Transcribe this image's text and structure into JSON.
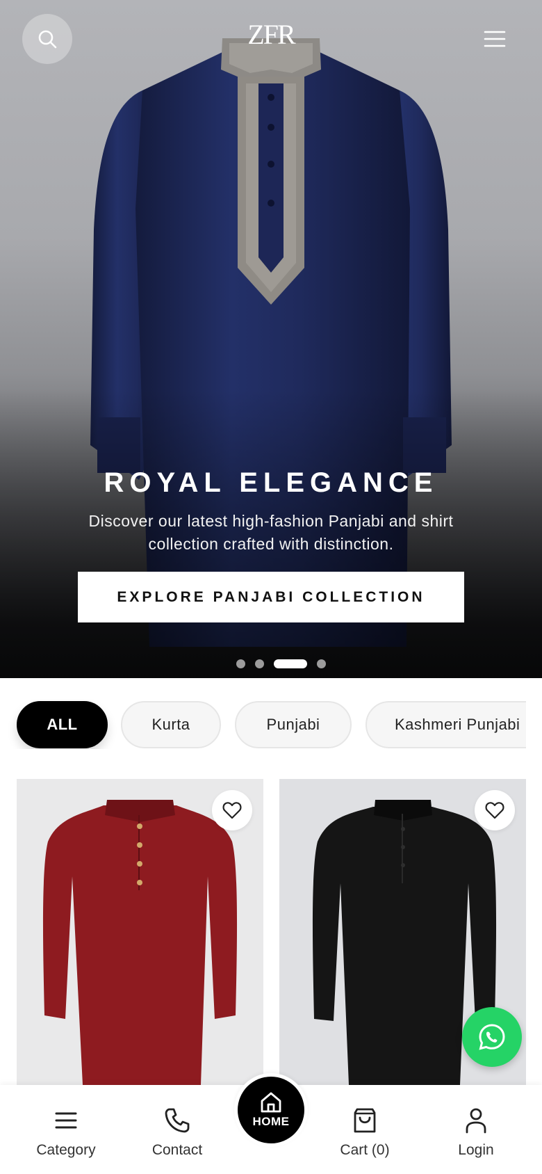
{
  "header": {
    "logo": "ZFR",
    "search_icon": "search-icon",
    "menu_icon": "hamburger-menu-icon"
  },
  "hero": {
    "title": "ROYAL ELEGANCE",
    "subtitle": "Discover our latest high-fashion Panjabi and shirt collection crafted with distinction.",
    "cta_label": "EXPLORE PANJABI COLLECTION",
    "slides_count": 4,
    "active_slide": 3
  },
  "filters": {
    "chips": [
      {
        "label": "ALL",
        "active": true
      },
      {
        "label": "Kurta",
        "active": false
      },
      {
        "label": "Punjabi",
        "active": false
      },
      {
        "label": "Kashmeri Punjabi",
        "active": false
      }
    ]
  },
  "products": [
    {
      "color": "#8e1b20",
      "favorite_icon": "heart-outline-icon"
    },
    {
      "color": "#151515",
      "favorite_icon": "heart-outline-icon"
    }
  ],
  "floating": {
    "whatsapp_icon": "whatsapp-icon"
  },
  "bottom_nav": {
    "category_label": "Category",
    "contact_label": "Contact",
    "home_label": "HOME",
    "cart_label": "Cart (0)",
    "login_label": "Login"
  },
  "colors": {
    "accent": "#000000",
    "whatsapp": "#25d366",
    "hero_kurta": "#1c2550",
    "embroidery": "#9a9690"
  }
}
